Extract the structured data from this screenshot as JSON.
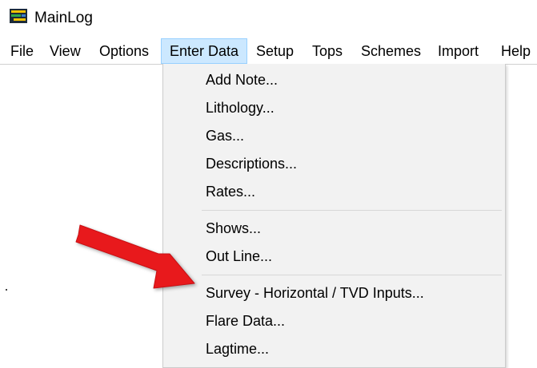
{
  "window": {
    "title": "MainLog",
    "icon": "mainlog-app-icon"
  },
  "menubar": {
    "items": [
      {
        "label": "File"
      },
      {
        "label": "View"
      },
      {
        "label": "Options"
      },
      {
        "label": "Enter Data",
        "active": true
      },
      {
        "label": "Setup"
      },
      {
        "label": "Tops"
      },
      {
        "label": "Schemes"
      },
      {
        "label": "Import"
      },
      {
        "label": "Help"
      }
    ]
  },
  "dropdown": {
    "items": [
      {
        "label": "Add Note..."
      },
      {
        "label": "Lithology..."
      },
      {
        "label": "Gas..."
      },
      {
        "label": "Descriptions..."
      },
      {
        "label": "Rates..."
      },
      {
        "label": "Shows..."
      },
      {
        "label": "Out Line..."
      },
      {
        "label": "Survey - Horizontal / TVD  Inputs..."
      },
      {
        "label": "Flare Data..."
      },
      {
        "label": "Lagtime..."
      }
    ]
  },
  "annotation": {
    "icon": "red-arrow-icon",
    "color": "#e8191c",
    "points_to": "Survey - Horizontal / TVD  Inputs..."
  },
  "colors": {
    "menu_highlight": "#cce8ff",
    "menu_highlight_border": "#99d1ff",
    "dropdown_bg": "#f2f2f2"
  }
}
